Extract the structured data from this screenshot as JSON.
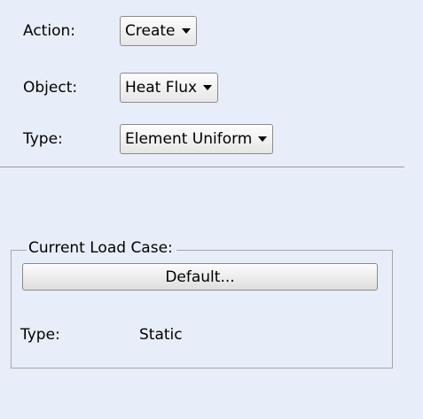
{
  "form": {
    "action": {
      "label": "Action:",
      "value": "Create"
    },
    "object": {
      "label": "Object:",
      "value": "Heat Flux"
    },
    "type": {
      "label": "Type:",
      "value": "Element Uniform"
    }
  },
  "load_case": {
    "group_title": "Current Load Case:",
    "button_label": "Default...",
    "type_label": "Type:",
    "type_value": "Static"
  }
}
